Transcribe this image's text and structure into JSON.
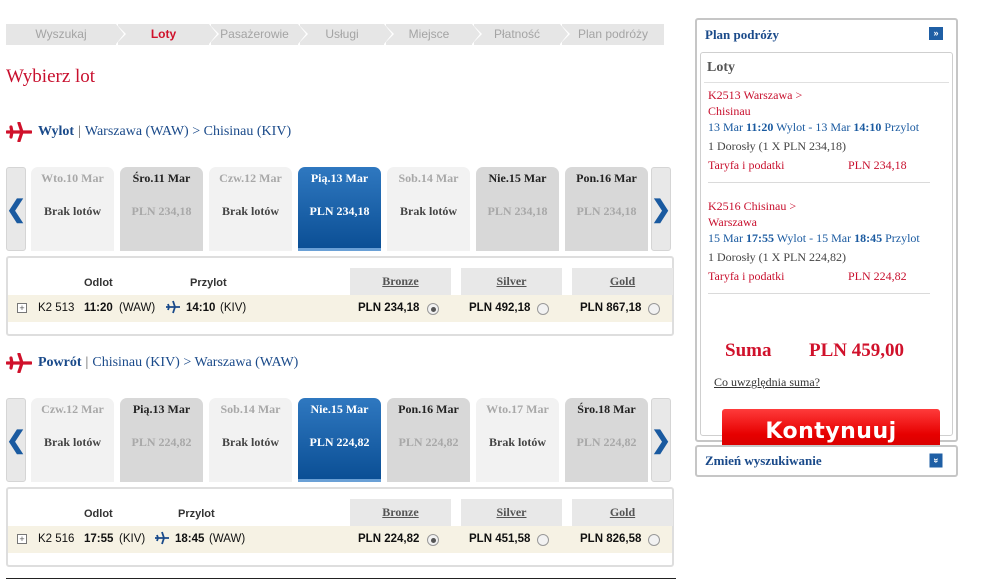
{
  "steps": [
    {
      "label": "Wyszukaj",
      "active": false
    },
    {
      "label": "Loty",
      "active": true
    },
    {
      "label": "Pasażerowie",
      "active": false
    },
    {
      "label": "Usługi",
      "active": false
    },
    {
      "label": "Miejsce",
      "active": false
    },
    {
      "label": "Płatność",
      "active": false
    },
    {
      "label": "Plan podróży",
      "active": false
    }
  ],
  "page_title": "Wybierz lot",
  "outbound": {
    "direction": "Wylot",
    "route": "Warszawa (WAW) > Chisinau (KIV)",
    "days": [
      {
        "name": "Wto.10 Mar",
        "value": "Brak lotów",
        "state": "empty"
      },
      {
        "name": "Śro.11 Mar",
        "value": "PLN 234,18",
        "state": "price"
      },
      {
        "name": "Czw.12 Mar",
        "value": "Brak lotów",
        "state": "empty"
      },
      {
        "name": "Pią.13 Mar",
        "value": "PLN 234,18",
        "state": "selected"
      },
      {
        "name": "Sob.14 Mar",
        "value": "Brak lotów",
        "state": "empty"
      },
      {
        "name": "Nie.15 Mar",
        "value": "PLN 234,18",
        "state": "price"
      },
      {
        "name": "Pon.16 Mar",
        "value": "PLN 234,18",
        "state": "price"
      }
    ],
    "table": {
      "col_odlot": "Odlot",
      "col_przylot": "Przylot",
      "fares": [
        "Bronze",
        "Silver",
        "Gold"
      ],
      "flight": "K2 513",
      "dep_time": "11:20",
      "dep_code": "(WAW)",
      "arr_time": "14:10",
      "arr_code": "(KIV)",
      "prices": [
        "PLN 234,18",
        "PLN 492,18",
        "PLN 867,18"
      ],
      "selected_fare": "Bronze"
    }
  },
  "return": {
    "direction": "Powrót",
    "route": "Chisinau (KIV) > Warszawa (WAW)",
    "days": [
      {
        "name": "Czw.12 Mar",
        "value": "Brak lotów",
        "state": "empty"
      },
      {
        "name": "Pią.13 Mar",
        "value": "PLN 224,82",
        "state": "price"
      },
      {
        "name": "Sob.14 Mar",
        "value": "Brak lotów",
        "state": "empty"
      },
      {
        "name": "Nie.15 Mar",
        "value": "PLN 224,82",
        "state": "selected"
      },
      {
        "name": "Pon.16 Mar",
        "value": "PLN 224,82",
        "state": "price"
      },
      {
        "name": "Wto.17 Mar",
        "value": "Brak lotów",
        "state": "empty"
      },
      {
        "name": "Śro.18 Mar",
        "value": "PLN 224,82",
        "state": "price"
      }
    ],
    "table": {
      "col_odlot": "Odlot",
      "col_przylot": "Przylot",
      "fares": [
        "Bronze",
        "Silver",
        "Gold"
      ],
      "flight": "K2 516",
      "dep_time": "17:55",
      "dep_code": "(KIV)",
      "arr_time": "18:45",
      "arr_code": "(WAW)",
      "prices": [
        "PLN 224,82",
        "PLN 451,58",
        "PLN 826,58"
      ],
      "selected_fare": "Bronze"
    }
  },
  "sidebar": {
    "title": "Plan podróży",
    "section": "Loty",
    "segments": [
      {
        "code": "K2513 Warszawa >",
        "dest": "Chisinau",
        "d1": "13 Mar",
        "t1": "11:20",
        "l1": "Wylot",
        "sep": "-",
        "d2": "13 Mar",
        "t2": "14:10",
        "l2": "Przylot",
        "pax": "1 Dorosły (1 X PLN 234,18)",
        "tax_label": "Taryfa i podatki",
        "tax_value": "PLN 234,18"
      },
      {
        "code": "K2516 Chisinau >",
        "dest": "Warszawa",
        "d1": "15 Mar",
        "t1": "17:55",
        "l1": "Wylot",
        "sep": "-",
        "d2": "15 Mar",
        "t2": "18:45",
        "l2": "Przylot",
        "pax": "1 Dorosły (1 X PLN 224,82)",
        "tax_label": "Taryfa i podatki",
        "tax_value": "PLN 224,82"
      }
    ],
    "suma_label": "Suma",
    "suma_value": "PLN 459,00",
    "info_link": "Co uwzględnia suma?",
    "continue_label": "Kontynuuj",
    "change_search": "Zmień wyszukiwanie"
  },
  "colors": {
    "brand_red": "#c8102e",
    "link_blue": "#1a4a8a",
    "selected_blue": "#0b4f95"
  }
}
